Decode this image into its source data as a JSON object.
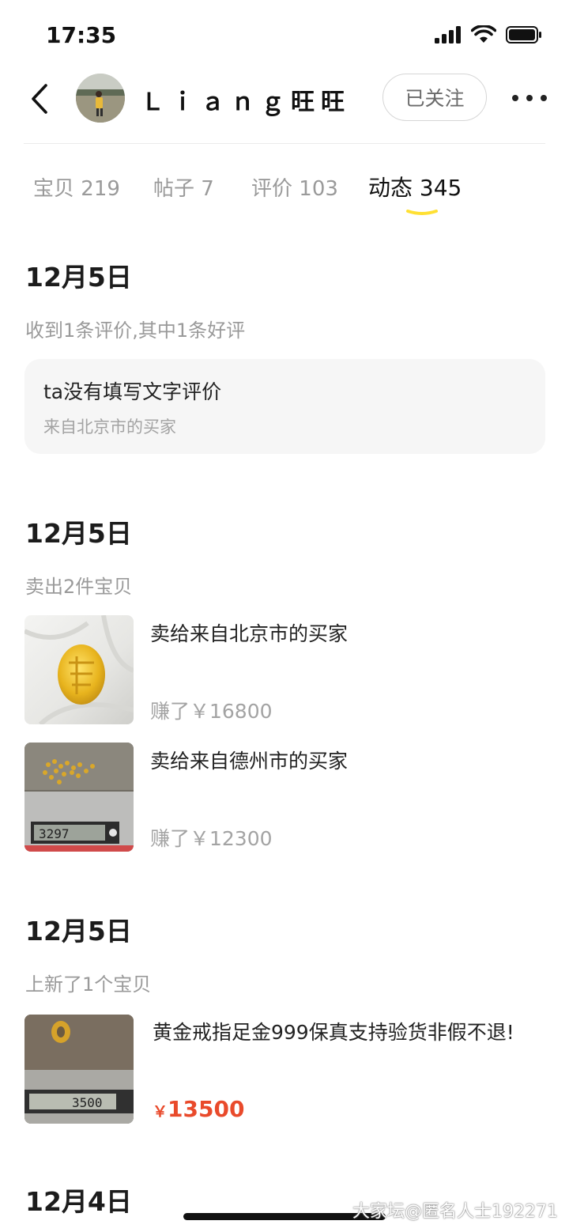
{
  "status_bar": {
    "time": "17:35"
  },
  "header": {
    "username": "Ｌｉａｎｇ旺旺",
    "follow_label": "已关注"
  },
  "tabs": [
    {
      "label": "宝贝",
      "count": "219",
      "active": false
    },
    {
      "label": "帖子",
      "count": "7",
      "active": false
    },
    {
      "label": "评价",
      "count": "103",
      "active": false
    },
    {
      "label": "动态",
      "count": "345",
      "active": true
    }
  ],
  "colors": {
    "accent_yellow": "#ffe033",
    "price_red": "#e94a2b"
  },
  "feed": {
    "review": {
      "date": "12月5日",
      "summary": "收到1条评价,其中1条好评",
      "text": "ta没有填写文字评价",
      "from": "来自北京市的买家"
    },
    "sold": {
      "date": "12月5日",
      "summary": "卖出2件宝贝",
      "items": [
        {
          "title": "卖给来自北京市的买家",
          "earned": "赚了￥16800",
          "thumb_icon": "gold-pendant-photo"
        },
        {
          "title": "卖给来自德州市的买家",
          "earned": "赚了￥12300",
          "thumb_icon": "gold-chain-on-scale-photo"
        }
      ]
    },
    "new_item": {
      "date": "12月5日",
      "summary": "上新了1个宝贝",
      "title": "黄金戒指足金999保真支持验货非假不退!",
      "price_symbol": "￥",
      "price": "13500",
      "thumb_icon": "gold-ring-on-scale-photo"
    },
    "next_date": "12月4日"
  },
  "watermark": "大家坛@匿名人士192271"
}
